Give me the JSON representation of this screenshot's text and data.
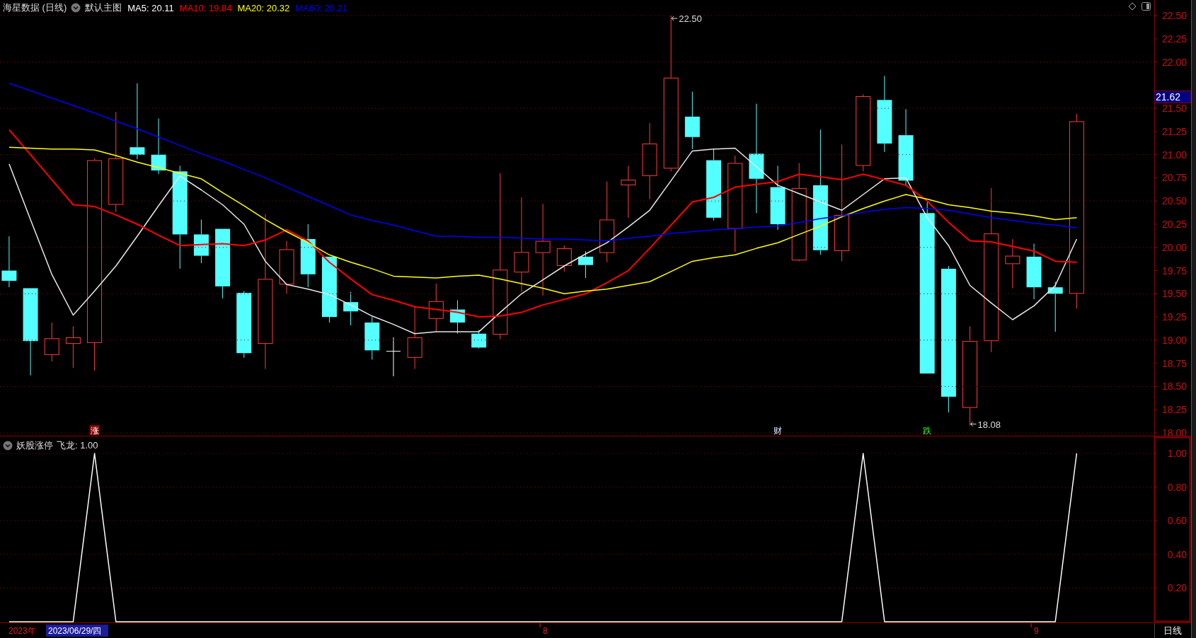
{
  "header": {
    "title": "海星数据 (日线)",
    "template": "默认主图",
    "readings": [
      {
        "text": "MA5: 20.11",
        "color": "#ffffff"
      },
      {
        "text": "MA10: 19.84",
        "color": "#ff0000"
      },
      {
        "text": "MA20: 20.32",
        "color": "#ffff00"
      },
      {
        "text": "MA60: 20.21",
        "color": "#0000ff"
      }
    ]
  },
  "main_chart": {
    "price_label": "21.62",
    "signals": [
      {
        "text": "涨",
        "kind": "boxed"
      },
      {
        "text": "财",
        "kind": "plain"
      },
      {
        "text": "跌",
        "kind": "down"
      }
    ],
    "chart_data": {
      "type": "line",
      "grid": true,
      "ylim": [
        18.0,
        22.5
      ],
      "yticks": [
        {
          "value": 22.5,
          "label": "22.50"
        },
        {
          "value": 22.25,
          "label": "22.25"
        },
        {
          "value": 22.0,
          "label": "22.00"
        },
        {
          "value": 21.5,
          "label": "21.50"
        },
        {
          "value": 21.25,
          "label": "21.25"
        },
        {
          "value": 21.0,
          "label": "21.00"
        },
        {
          "value": 20.75,
          "label": "20.75"
        },
        {
          "value": 20.5,
          "label": "20.50"
        },
        {
          "value": 20.25,
          "label": "20.25"
        },
        {
          "value": 20.0,
          "label": "20.00"
        },
        {
          "value": 19.75,
          "label": "19.75"
        },
        {
          "value": 19.5,
          "label": "19.50"
        },
        {
          "value": 19.25,
          "label": "19.25"
        },
        {
          "value": 19.0,
          "label": "19.00"
        },
        {
          "value": 18.75,
          "label": "18.75"
        },
        {
          "value": 18.5,
          "label": "18.50"
        },
        {
          "value": 18.25,
          "label": "18.25"
        },
        {
          "value": 18.0,
          "label": "18.00"
        }
      ],
      "series": [
        {
          "color": "#e8e8e8",
          "values": [
            20.9,
            20.3,
            19.71,
            19.27,
            19.53,
            19.8,
            20.12,
            20.45,
            20.77,
            20.62,
            20.46,
            20.25,
            19.85,
            19.6,
            19.55,
            19.49,
            19.38,
            19.26,
            19.17,
            19.07,
            19.09,
            19.09,
            19.09,
            19.3,
            19.5,
            19.65,
            19.8,
            19.93,
            20.05,
            20.22,
            20.4,
            20.72,
            21.04,
            21.06,
            21.07,
            20.87,
            20.67,
            20.58,
            20.49,
            20.4,
            20.57,
            20.74,
            20.75,
            20.32,
            20.02,
            19.59,
            19.4,
            19.22,
            19.37,
            19.59,
            20.09
          ]
        },
        {
          "color": "#ff0000",
          "values": [
            21.27,
            21.0,
            20.73,
            20.46,
            20.44,
            20.35,
            20.25,
            20.13,
            20.02,
            20.03,
            20.04,
            20.02,
            20.08,
            20.19,
            20.07,
            19.84,
            19.66,
            19.49,
            19.43,
            19.36,
            19.33,
            19.3,
            19.25,
            19.26,
            19.3,
            19.38,
            19.44,
            19.5,
            19.62,
            19.75,
            19.99,
            20.24,
            20.49,
            20.54,
            20.65,
            20.68,
            20.71,
            20.79,
            20.76,
            20.73,
            20.79,
            20.73,
            20.67,
            20.5,
            20.27,
            20.07,
            20.06,
            20.01,
            19.96,
            19.85,
            19.84
          ]
        },
        {
          "color": "#ffff00",
          "values": [
            21.08,
            21.07,
            21.06,
            21.06,
            21.05,
            20.99,
            20.92,
            20.86,
            20.8,
            20.74,
            20.59,
            20.45,
            20.3,
            20.17,
            20.05,
            19.92,
            19.84,
            19.77,
            19.69,
            19.68,
            19.67,
            19.69,
            19.7,
            19.66,
            19.61,
            19.56,
            19.5,
            19.53,
            19.55,
            19.59,
            19.63,
            19.74,
            19.85,
            19.89,
            19.92,
            19.99,
            20.05,
            20.14,
            20.23,
            20.33,
            20.42,
            20.5,
            20.57,
            20.52,
            20.46,
            20.43,
            20.39,
            20.37,
            20.34,
            20.3,
            20.32
          ]
        },
        {
          "color": "#0000ff",
          "values": [
            21.77,
            21.69,
            21.61,
            21.53,
            21.45,
            21.36,
            21.28,
            21.19,
            21.1,
            21.01,
            20.93,
            20.84,
            20.75,
            20.65,
            20.55,
            20.45,
            20.35,
            20.29,
            20.24,
            20.18,
            20.12,
            20.12,
            20.11,
            20.11,
            20.1,
            20.09,
            20.09,
            20.08,
            20.07,
            20.1,
            20.12,
            20.15,
            20.17,
            20.19,
            20.2,
            20.22,
            20.23,
            20.27,
            20.31,
            20.34,
            20.38,
            20.41,
            20.43,
            20.42,
            20.4,
            20.36,
            20.32,
            20.29,
            20.26,
            20.24,
            20.21
          ]
        }
      ],
      "annotations": [
        {
          "text": "22.50"
        },
        {
          "text": "18.08"
        }
      ]
    }
  },
  "indicator": {
    "title": "妖股涨停",
    "reading": "飞龙: 1.00",
    "chart_data": {
      "type": "line",
      "grid": true,
      "ylim": [
        0,
        1.0
      ],
      "yticks": [
        {
          "value": 1.0,
          "label": "1.00"
        },
        {
          "value": 0.8,
          "label": "0.80"
        },
        {
          "value": 0.6,
          "label": "0.60"
        },
        {
          "value": 0.4,
          "label": "0.40"
        },
        {
          "value": 0.2,
          "label": "0.20"
        }
      ],
      "series": [
        {
          "color": "#ffffff",
          "values": [
            0,
            0,
            0,
            0,
            1,
            0,
            0,
            0,
            0,
            0,
            0,
            0,
            0,
            0,
            0,
            0,
            0,
            0,
            0,
            0,
            0,
            0,
            0,
            0,
            0,
            0,
            0,
            0,
            0,
            0,
            0,
            0,
            0,
            0,
            0,
            0,
            0,
            0,
            0,
            0,
            1,
            0,
            0,
            0,
            0,
            0,
            0,
            0,
            0,
            0,
            1
          ]
        }
      ]
    }
  },
  "time_bar": {
    "year": "2023年",
    "cursor_date": "2023/06/29/四",
    "month_marks": [
      "8",
      "9"
    ],
    "period": "日线"
  }
}
